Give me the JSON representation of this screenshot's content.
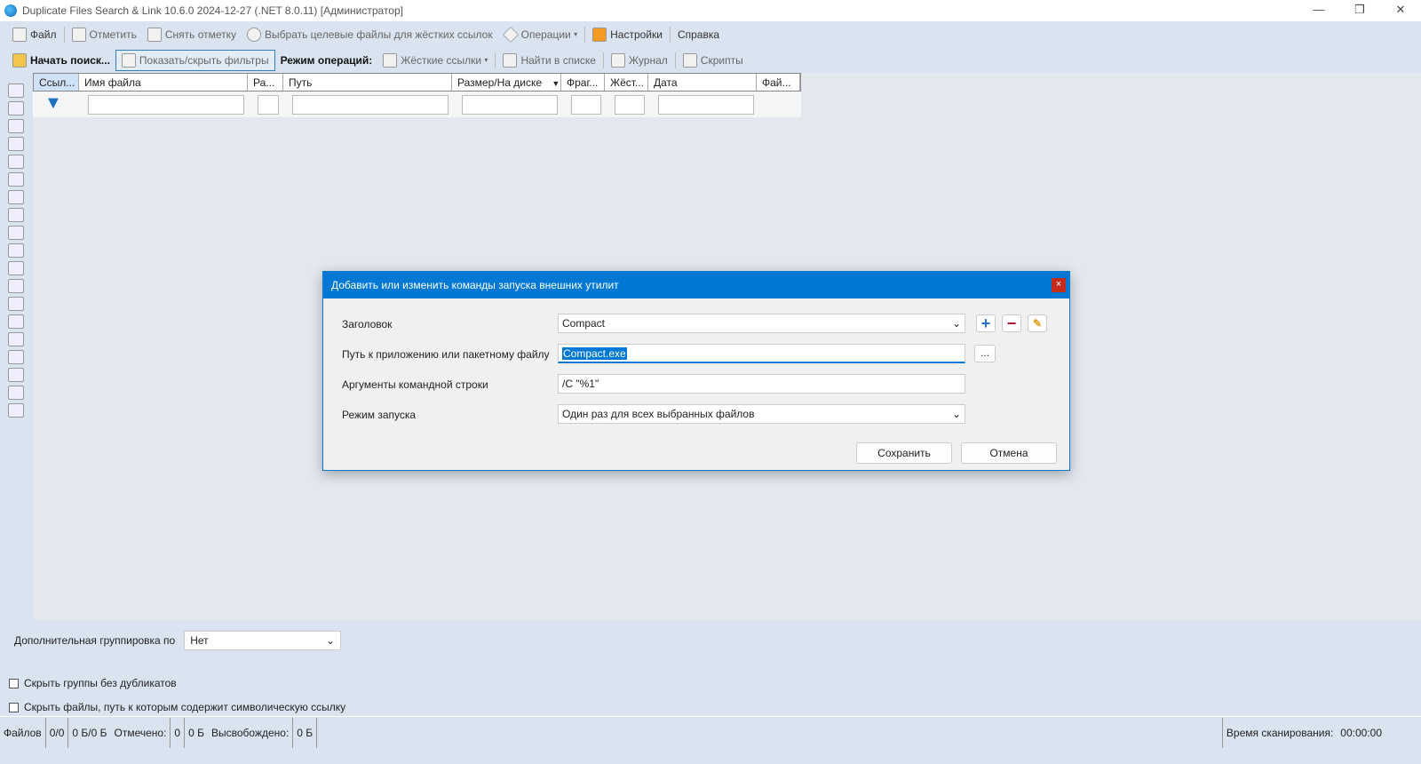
{
  "window": {
    "title": "Duplicate Files Search & Link 10.6.0 2024-12-27 (.NET 8.0.11) [Администратор]",
    "minimize": "—",
    "restore": "❐",
    "close": "✕"
  },
  "toolbar1": {
    "file": "Файл",
    "mark": "Отметить",
    "unmark": "Снять отметку",
    "select_targets": "Выбрать целевые файлы для жёстких ссылок",
    "operations": "Операции",
    "settings": "Настройки",
    "help": "Справка"
  },
  "toolbar2": {
    "start_search": "Начать поиск...",
    "toggle_filters": "Показать/скрыть фильтры",
    "mode_label": "Режим операций:",
    "hardlinks": "Жёсткие ссылки",
    "find_in_list": "Найти в списке",
    "log": "Журнал",
    "scripts": "Скрипты"
  },
  "grid": {
    "columns": [
      "Ссыл...",
      "Имя файла",
      "Ра...",
      "Путь",
      "Размер/На диске",
      "Фраг...",
      "Жёст...",
      "Дата",
      "Фай..."
    ]
  },
  "grouping": {
    "label": "Дополнительная группировка по",
    "value": "Нет"
  },
  "checkboxes": {
    "hide_groups": "Скрыть группы без дубликатов",
    "hide_symlinks": "Скрыть файлы, путь к которым содержит символическую ссылку"
  },
  "status": {
    "files_label": "Файлов",
    "files": "0/0",
    "size": "0 Б/0 Б",
    "marked_label": "Отмечено:",
    "marked": "0",
    "marked_size": "0 Б",
    "freed_label": "Высвобождено:",
    "freed": "0 Б",
    "scan_time_label": "Время сканирования:",
    "scan_time": "00:00:00"
  },
  "dialog": {
    "title": "Добавить или изменить команды запуска внешних утилит",
    "close": "×",
    "caption_label": "Заголовок",
    "caption_value": "Compact",
    "path_label": "Путь к приложению или пакетному файлу",
    "path_value": "Compact.exe",
    "browse": "...",
    "args_label": "Аргументы командной строки",
    "args_value": "/C \"%1\"",
    "mode_label": "Режим запуска",
    "mode_value": "Один раз для всех выбранных файлов",
    "save": "Сохранить",
    "cancel": "Отмена"
  }
}
